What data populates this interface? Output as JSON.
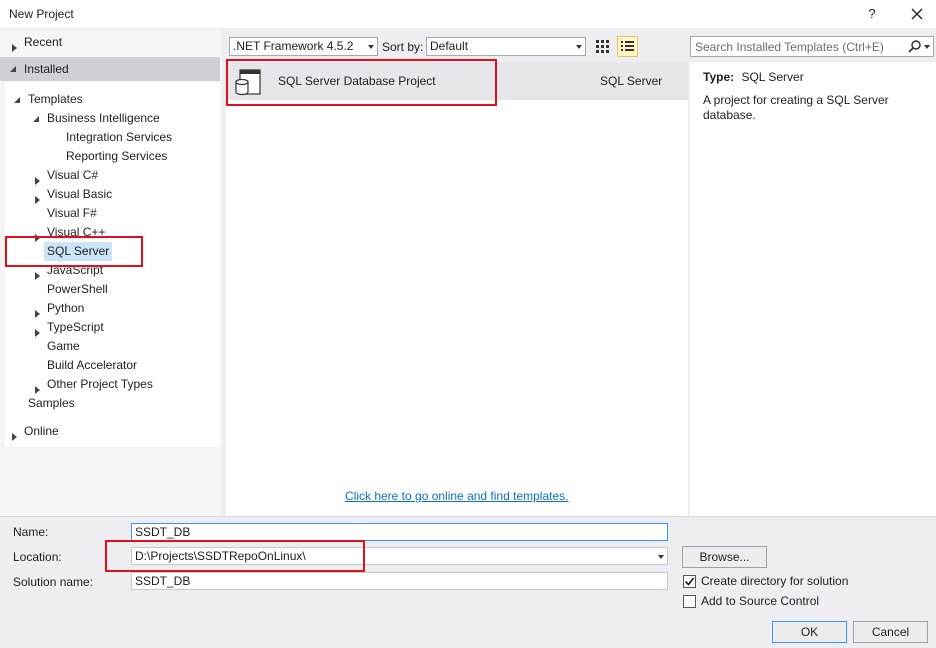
{
  "window": {
    "title": "New Project",
    "help_label": "?"
  },
  "nav": {
    "recent": "Recent",
    "installed": "Installed",
    "templates": "Templates",
    "items": [
      "Business Intelligence",
      "Integration Services",
      "Reporting Services",
      "Visual C#",
      "Visual Basic",
      "Visual F#",
      "Visual C++",
      "SQL Server",
      "JavaScript",
      "PowerShell",
      "Python",
      "TypeScript",
      "Game",
      "Build Accelerator",
      "Other Project Types"
    ],
    "samples": "Samples",
    "online": "Online"
  },
  "toolbar": {
    "framework": ".NET Framework 4.5.2",
    "sort_label": "Sort by:",
    "sort_value": "Default"
  },
  "search": {
    "placeholder": "Search Installed Templates (Ctrl+E)"
  },
  "template": {
    "name": "SQL Server Database Project",
    "category": "SQL Server"
  },
  "online_link": "Click here to go online and find templates.",
  "details": {
    "type_label": "Type:",
    "type_value": "SQL Server",
    "description": "A project for creating a SQL Server database."
  },
  "form": {
    "name_label": "Name:",
    "name_value": "SSDT_DB",
    "location_label": "Location:",
    "location_value": "D:\\Projects\\SSDTRepoOnLinux\\",
    "solution_label": "Solution name:",
    "solution_value": "SSDT_DB",
    "browse": "Browse...",
    "create_dir_label": "Create directory for solution",
    "create_dir_checked": true,
    "source_control_label": "Add to Source Control",
    "source_control_checked": false,
    "ok": "OK",
    "cancel": "Cancel"
  },
  "colors": {
    "highlight": "#e0101b",
    "selection": "#cce4f7",
    "link": "#0e70c0"
  }
}
